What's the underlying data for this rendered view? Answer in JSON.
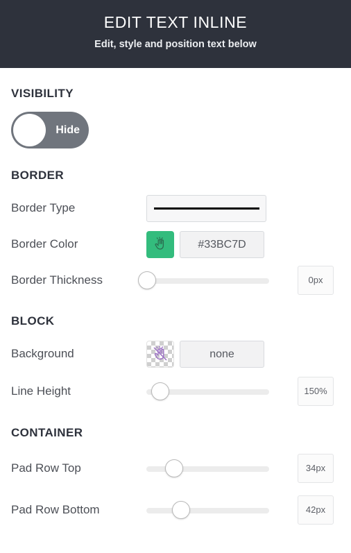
{
  "header": {
    "title": "EDIT TEXT INLINE",
    "subtitle": "Edit, style and position text below",
    "background": "#2e323c"
  },
  "sections": {
    "visibility": {
      "heading": "VISIBILITY",
      "toggle": {
        "label": "Hide",
        "state": "off",
        "knob_side": "left",
        "track_color": "#70757d"
      }
    },
    "border": {
      "heading": "BORDER",
      "border_type": {
        "label": "Border Type",
        "value": "solid",
        "line_color": "#000000"
      },
      "border_color": {
        "label": "Border Color",
        "value": "#33BC7D",
        "swatch_color": "#33bc7d",
        "swatch_icon": "hand-pointer-icon"
      },
      "border_thickness": {
        "label": "Border Thickness",
        "value": "0px",
        "slider_percent": 0
      }
    },
    "block": {
      "heading": "BLOCK",
      "background": {
        "label": "Background",
        "value": "none",
        "swatch_pattern": "transparent-checkerboard",
        "swatch_icon": "hand-pointer-slash-icon"
      },
      "line_height": {
        "label": "Line Height",
        "value": "150%",
        "slider_percent": 11
      }
    },
    "container": {
      "heading": "CONTAINER",
      "pad_row_top": {
        "label": "Pad Row Top",
        "value": "34px",
        "slider_percent": 22
      },
      "pad_row_bottom": {
        "label": "Pad Row Bottom",
        "value": "42px",
        "slider_percent": 28
      }
    }
  }
}
